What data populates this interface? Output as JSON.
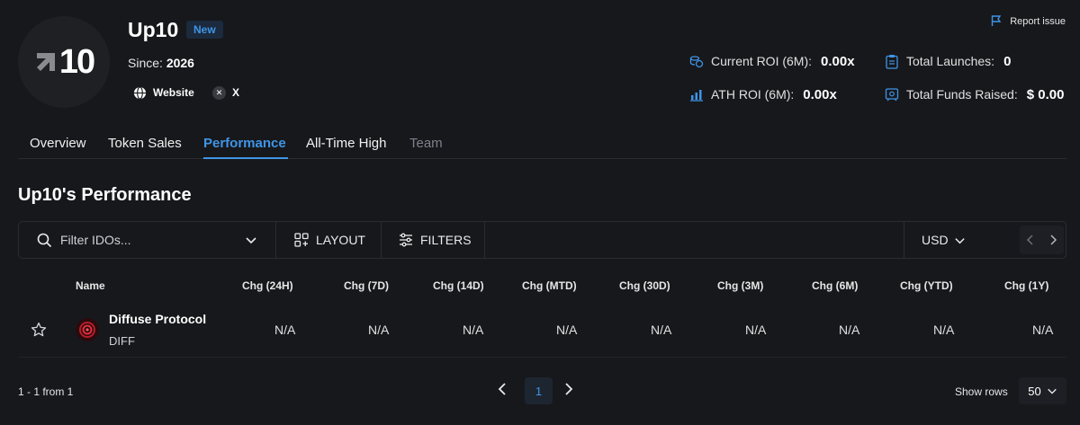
{
  "project": {
    "name": "Up10",
    "badge": "New",
    "logo_text": "10",
    "since_label": "Since:",
    "since_value": "2026",
    "links": {
      "website": "Website",
      "x": "X"
    }
  },
  "report_issue": "Report issue",
  "stats": {
    "current_roi_label": "Current ROI (6M):",
    "current_roi_value": "0.00x",
    "ath_roi_label": "ATH ROI (6M):",
    "ath_roi_value": "0.00x",
    "total_launches_label": "Total Launches:",
    "total_launches_value": "0",
    "total_funds_label": "Total Funds Raised:",
    "total_funds_value": "$ 0.00"
  },
  "tabs": [
    {
      "label": "Overview"
    },
    {
      "label": "Token Sales"
    },
    {
      "label": "Performance",
      "active": true
    },
    {
      "label": "All-Time High"
    },
    {
      "label": "Team"
    }
  ],
  "section_title": "Up10's Performance",
  "toolbar": {
    "search_placeholder": "Filter IDOs...",
    "layout": "LAYOUT",
    "filters": "FILTERS",
    "currency": "USD"
  },
  "table": {
    "columns": [
      "Name",
      "Chg (24H)",
      "Chg (7D)",
      "Chg (14D)",
      "Chg (MTD)",
      "Chg (30D)",
      "Chg (3M)",
      "Chg (6M)",
      "Chg (YTD)",
      "Chg (1Y)"
    ],
    "rows": [
      {
        "name": "Diffuse Protocol",
        "symbol": "DIFF",
        "values": [
          "N/A",
          "N/A",
          "N/A",
          "N/A",
          "N/A",
          "N/A",
          "N/A",
          "N/A",
          "N/A"
        ]
      }
    ]
  },
  "footer": {
    "count": "1 - 1 from 1",
    "current_page": "1",
    "show_rows_label": "Show rows",
    "rows_per_page": "50"
  },
  "colors": {
    "accent": "#3f95e6",
    "background": "#17181c"
  }
}
